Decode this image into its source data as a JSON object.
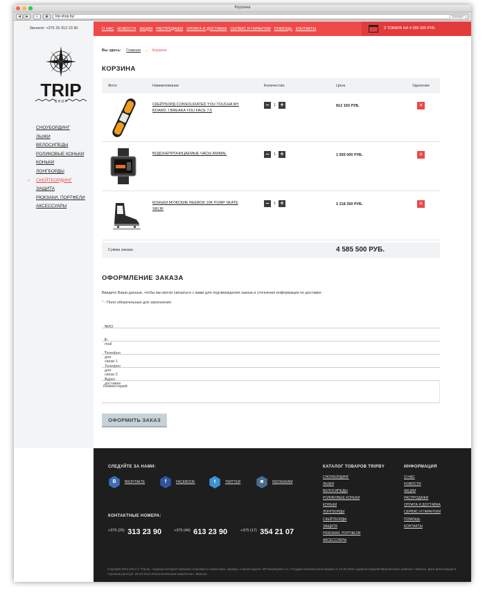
{
  "browser": {
    "window_title": "Корзина",
    "url": "trip-shop.by/",
    "reader_label": "Reader"
  },
  "header": {
    "phone": "Звоните: +375 25 913 23 90",
    "menu": [
      "О НАС",
      "НОВОСТИ",
      "АКЦИИ",
      "РАСПРОДАЖИ",
      "ОПЛАТА И ДОСТАВКА",
      "СЕРВИС И ГАРАНТИИ",
      "ПОМОЩЬ",
      "КОНТАКТЫ"
    ],
    "cart_summary": "3 ТОВАРА НА 4 585 500 РУБ."
  },
  "logo": {
    "text": "TRIP",
    "sub": "S H O P"
  },
  "sidebar": {
    "categories": [
      "СНОУБОРДИНГ",
      "ЛЫЖИ",
      "ВЕЛОСИПЕДЫ",
      "РОЛИКОВЫЕ КОНЬКИ",
      "КОНЬКИ",
      "ЛОНГБОРДЫ",
      "СКЕЙТБОРДИНГ",
      "ЗАЩИТА",
      "РЮКЗАКИ, ПОРТФЕЛИ",
      "АКСЕССУАРЫ"
    ],
    "active": "СКЕЙТБОРДИНГ"
  },
  "breadcrumb": {
    "label": "Вы здесь:",
    "home": "Главная",
    "current": "Корзина"
  },
  "cart": {
    "title": "КОРЗИНА",
    "columns": {
      "photo": "Фото",
      "name": "Наименование",
      "qty": "Количество",
      "price": "Цена",
      "remove": "Удаление"
    },
    "items": [
      {
        "name": "СКЕЙТБОРД CONSOLIDATED YOU TOUCHA MY BOARD, I BREAKA YOU FACE 7.5",
        "qty": "1",
        "price": "812 150 РУБ."
      },
      {
        "name": "ВОДОНЕПРОНИЦАЕМЫЕ ЧАСЫ ANIMAL",
        "qty": "1",
        "price": "1 555 000 РУБ."
      },
      {
        "name": "КОНЬКИ МУЖСКИЕ REEBOK 10K PUMP SKATE SR/JR",
        "qty": "1",
        "price": "2 218 350 РУБ."
      }
    ],
    "minus": "–",
    "plus": "+",
    "remove": "✕",
    "total_label": "Сумма заказа:",
    "total_value": "4 585 500 РУБ."
  },
  "order": {
    "title": "ОФОРМЛЕНИЕ ЗАКАЗА",
    "intro": "Введите Ваши данные, чтобы мы могли связаться с вами для подтверждения заказа и уточнения информации по доставке.",
    "required_mark": "*",
    "required_note": " - Поля обязательные для заполнения",
    "fields": [
      {
        "label": "ФИО",
        "required": "*"
      },
      {
        "label": "E-mail",
        "required": "*"
      },
      {
        "label": "Телефон для связи 1",
        "required": "*"
      },
      {
        "label": "Телефон для связи 2",
        "required": ""
      },
      {
        "label": "Адрес доставки",
        "required": "*"
      }
    ],
    "comment_label": "Комментарий",
    "submit": "ОФОРМИТЬ ЗАКАЗ"
  },
  "footer": {
    "follow_title": "СЛЕДУЙТЕ ЗА НАМИ:",
    "social": [
      {
        "icon": "vk-icon",
        "glyph": "B",
        "label": "ВКОНТАКТЕ",
        "color": "#3d6fb2"
      },
      {
        "icon": "facebook-icon",
        "glyph": "f",
        "label": "FACEBOOK",
        "color": "#2f56a2"
      },
      {
        "icon": "twitter-icon",
        "glyph": "t",
        "label": "TWITTER",
        "color": "#3c93d6"
      },
      {
        "icon": "instagram-icon",
        "glyph": "◙",
        "label": "INSTAGRAM",
        "color": "#4a6e90"
      }
    ],
    "contacts_title": "КОНТАКТНЫЕ НОМЕРА:",
    "phones": [
      {
        "code": "+375 (25)",
        "number": "313 23 90"
      },
      {
        "code": "+375 (44)",
        "number": "613 23 90"
      },
      {
        "code": "+375 (17)",
        "number": "354 21 07"
      }
    ],
    "catalog_title": "КАТАЛОГ ТОВАРОВ TRIPBY",
    "catalog": [
      "СНОУБОРДИНГ",
      "ЛЫЖИ",
      "ВЕЛОСИПЕДЫ",
      "РОЛИКОВЫЕ КОНЬКИ",
      "КОНЬКИ",
      "ЛОНГБОРДЫ",
      "СКЕЙТБОРДЫ",
      "ЗАЩИТА",
      "РЮКЗАКИ, ПОРТФЕЛИ",
      "АКСЕССУАРЫ"
    ],
    "info_title": "ИНФОРМАЦИЯ",
    "info": [
      "О НАС",
      "НОВОСТИ",
      "АКЦИИ",
      "РАСПРОДАЖИ",
      "ОПЛАТА И ДОСТАВКА",
      "СЕРВИС И ГАРАНТИИ",
      "ПОМОЩЬ",
      "КОНТАКТЫ"
    ],
    "copyright": "Copyright 2012-2014 © Trip.by - модный интернет-магазин спортивного инвентаря, одежды, и аксессуаров. ИП Казанцева А.С. Государственная регистрация от 14.03.2012 Администрацией Фрунзенского района г. Минска. Дата регистрации в торговом реестре: 25.03.2012 Исполнительным комитетом г. Минска."
  },
  "colors": {
    "accent": "#ef4a4a",
    "footer_bg": "#1e1e1f",
    "sidebar_bg": "#f3f4f6"
  }
}
